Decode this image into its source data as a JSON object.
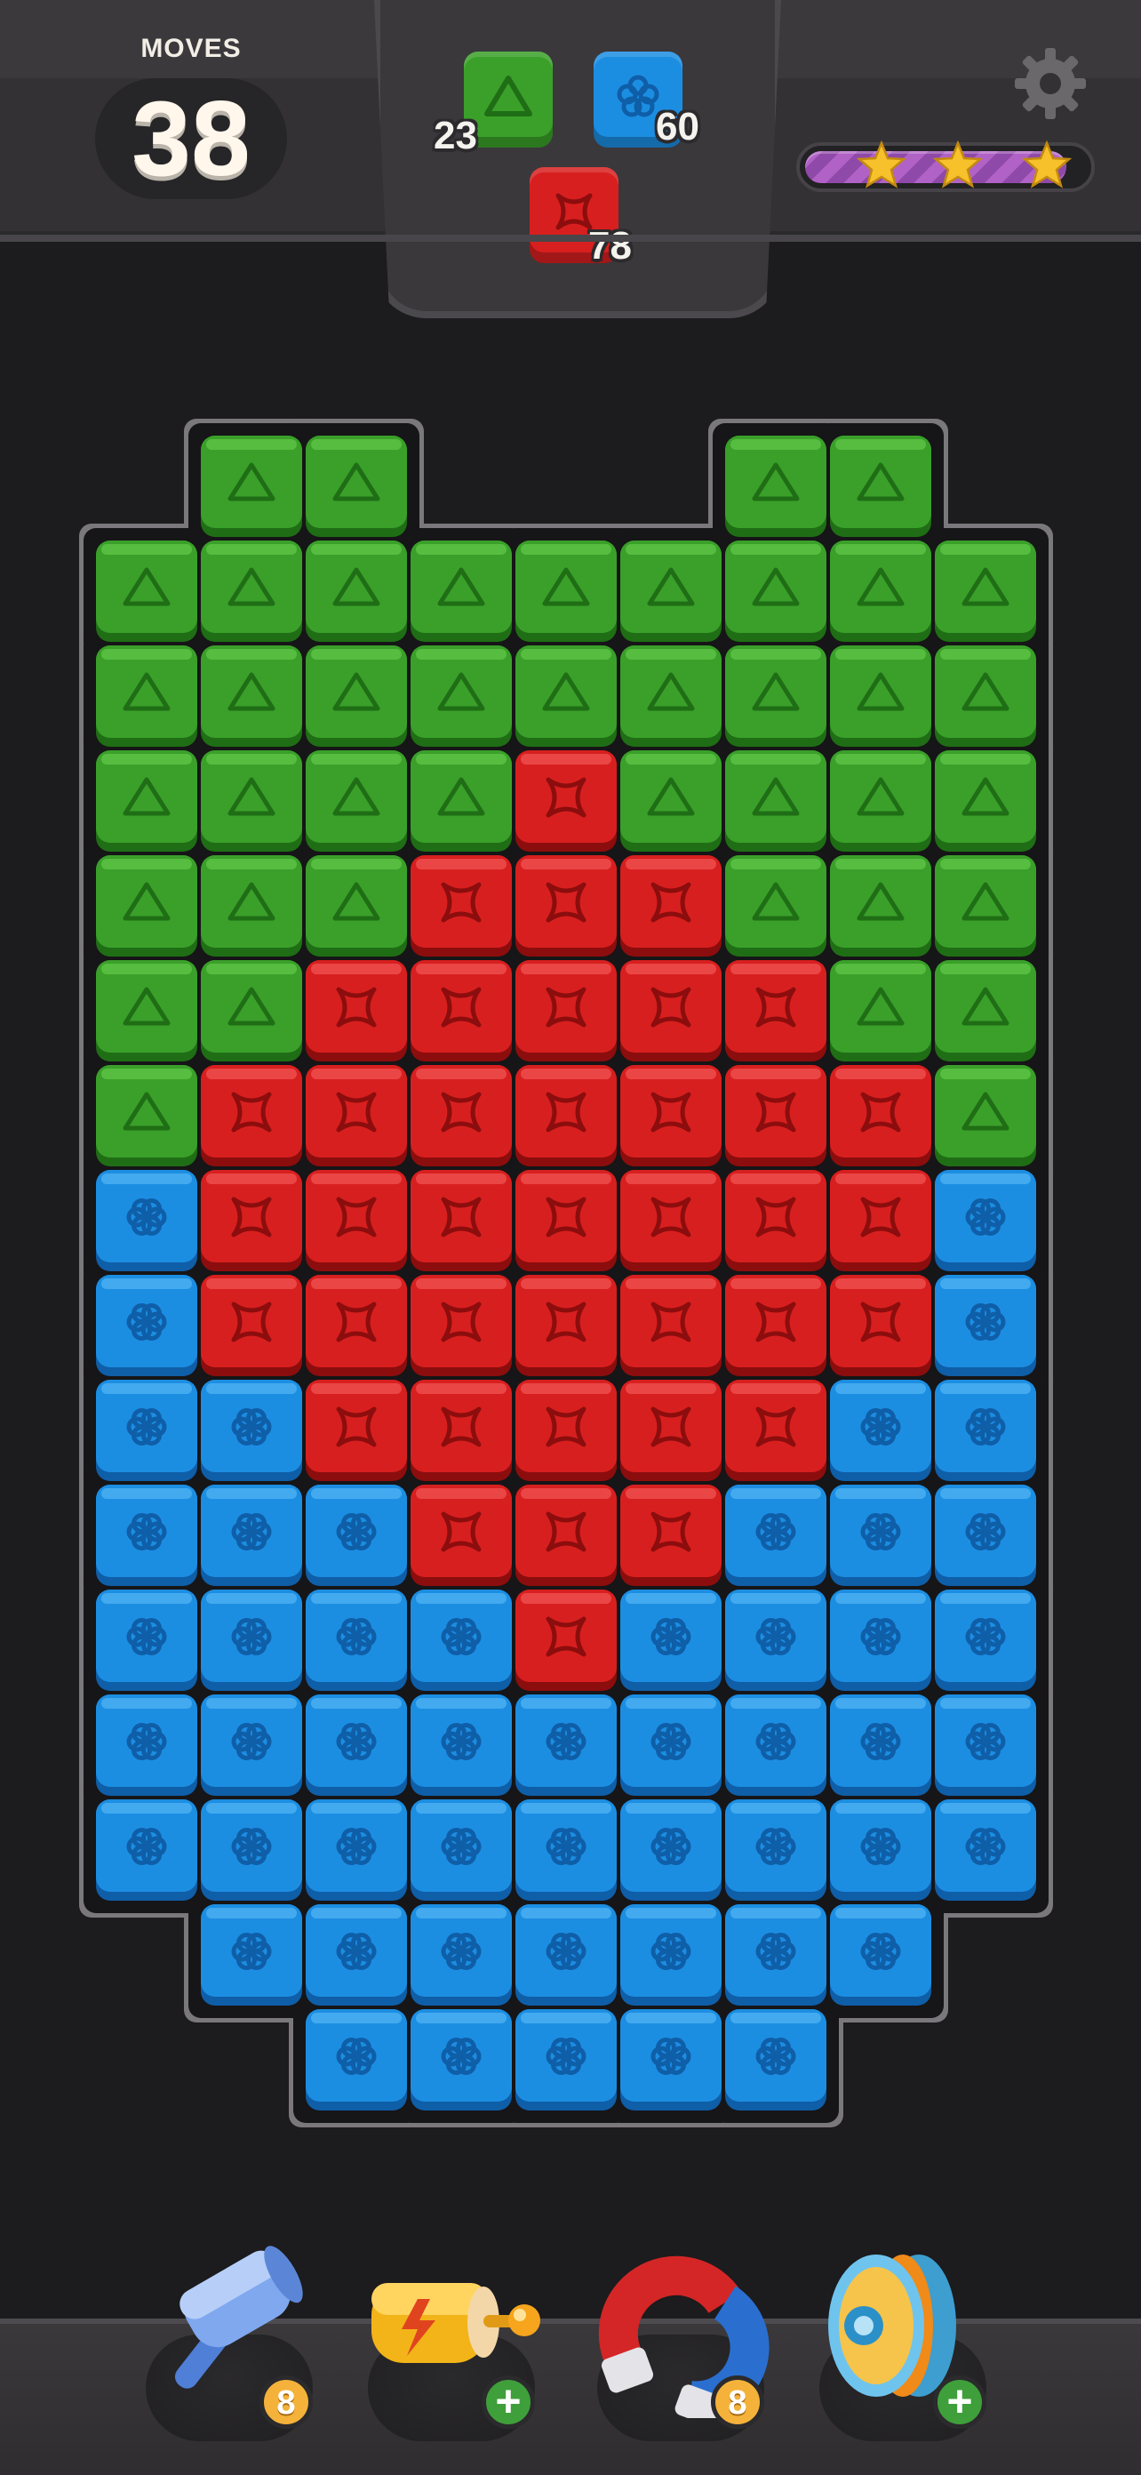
{
  "hud": {
    "moves_label": "MOVES",
    "moves_value": "38",
    "settings_icon": "gear-icon",
    "star_progress": 0.93,
    "stars": [
      "star-icon",
      "star-icon",
      "star-icon"
    ]
  },
  "goals": [
    {
      "color": "green",
      "icon": "triangle-icon",
      "count": "23"
    },
    {
      "color": "blue",
      "icon": "flower-icon",
      "count": "60"
    },
    {
      "color": "red",
      "icon": "cross-icon",
      "count": "78"
    }
  ],
  "colors": {
    "green": "#3aa02a",
    "blue": "#1c8ee2",
    "red": "#d81f1f",
    "star": "#f6c12b",
    "progress": "#a255bd",
    "badge_orange": "#f4b23a",
    "badge_green": "#3f9f3b"
  },
  "board": {
    "legend": {
      "G": "green",
      "R": "red",
      "B": "blue",
      ".": "empty"
    },
    "rows": [
      ".GG...GG.",
      "GGGGGGGGG",
      "GGGGGGGGG",
      "GGGGRGGGG",
      "GGGRRRGGG",
      "GGRRRRRGG",
      "GRRRRRRRG",
      "BRRRRRRRB",
      "BRRRRRRRB",
      "BBRRRRRBB",
      "BBBRRRBBB",
      "BBBBRBBBB",
      "BBBBBBBBB",
      "BBBBBBBBB",
      ".BBBBBBB.",
      "..BBBBB.."
    ]
  },
  "boosters": [
    {
      "name": "hammer",
      "icon": "hammer-icon",
      "count": "8"
    },
    {
      "name": "blaster",
      "icon": "blaster-icon",
      "count": "+"
    },
    {
      "name": "magnet",
      "icon": "magnet-icon",
      "count": "8"
    },
    {
      "name": "yoyo",
      "icon": "yoyo-icon",
      "count": "+"
    }
  ]
}
